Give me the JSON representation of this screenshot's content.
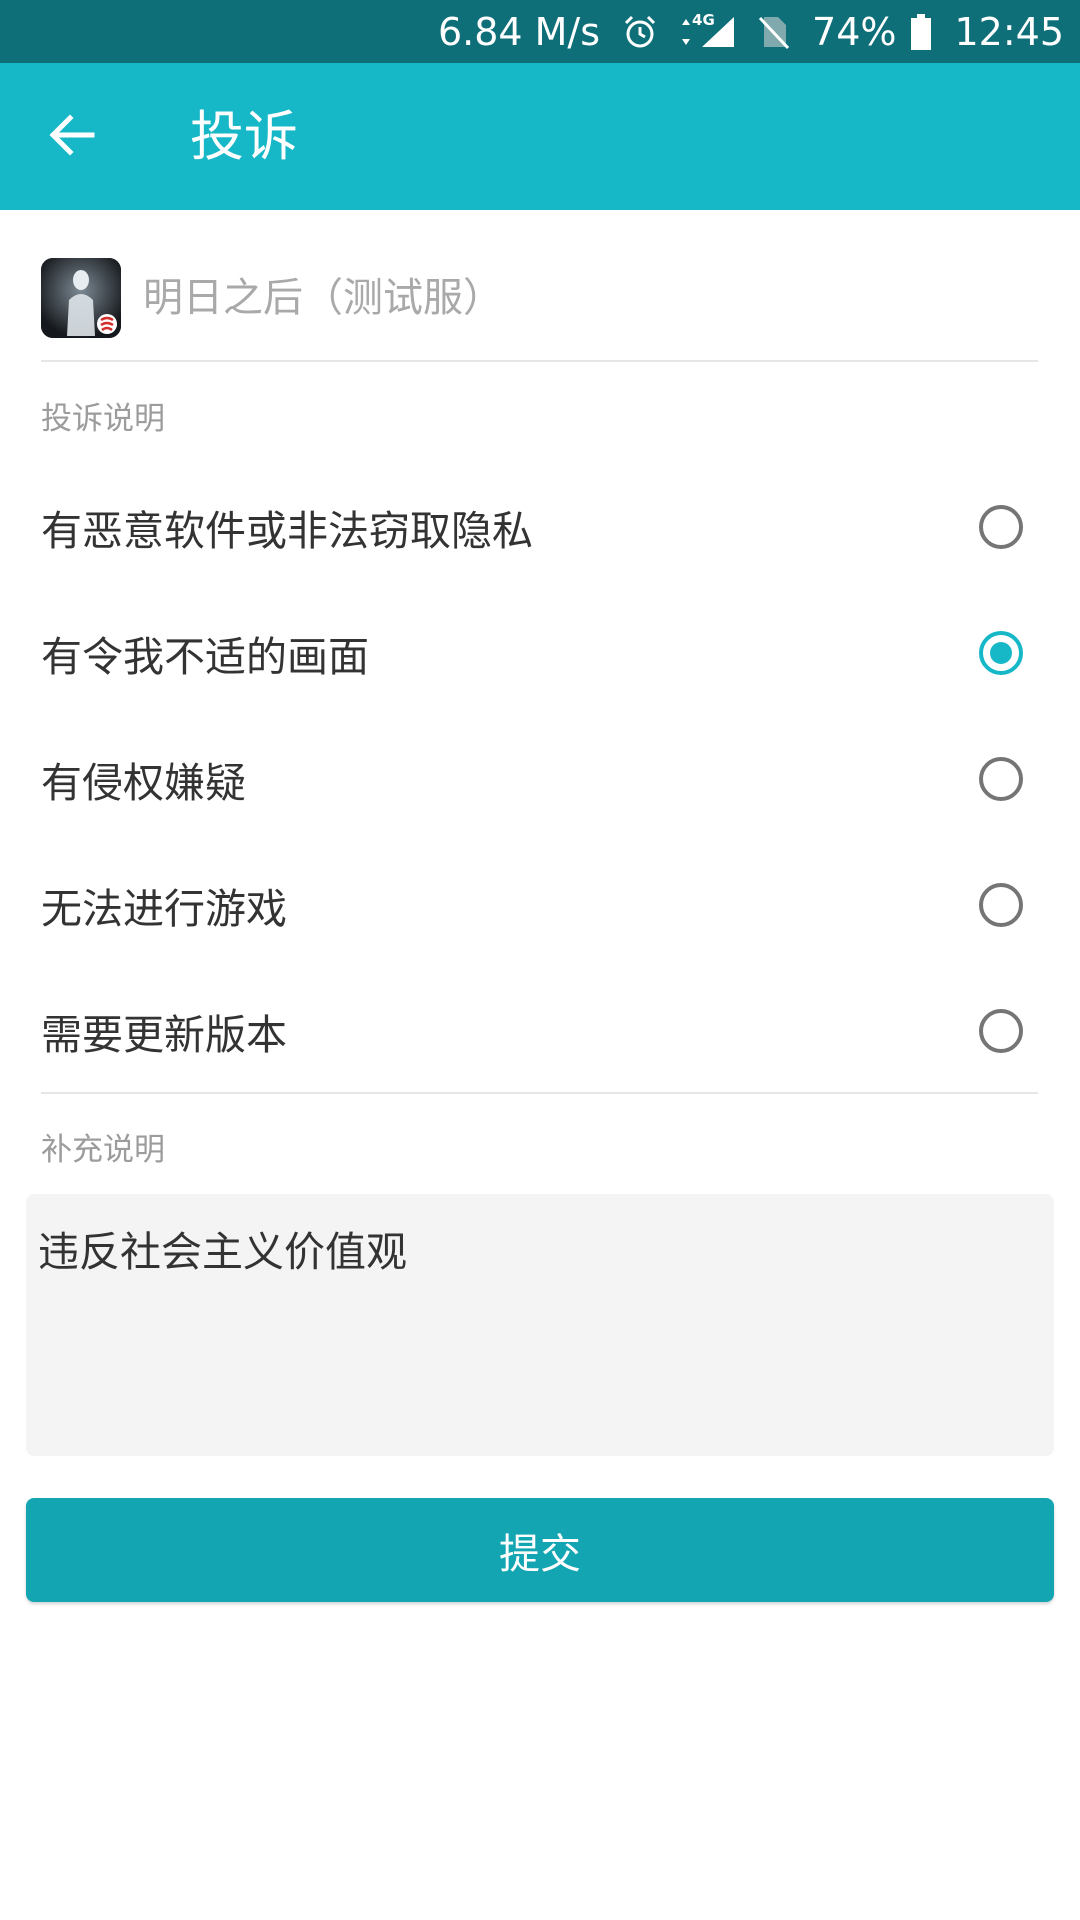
{
  "status_bar": {
    "net_speed": "6.84 M/s",
    "network_label": "4G",
    "battery": "74%",
    "time": "12:45",
    "icons": [
      "alarm-icon",
      "data-arrows-icon",
      "signal-icon",
      "no-sim-icon",
      "battery-icon"
    ]
  },
  "header": {
    "title": "投诉",
    "back_icon": "arrow-left-icon"
  },
  "app": {
    "name": "明日之后（测试服）"
  },
  "complaint": {
    "section_label": "投诉说明",
    "options": [
      {
        "label": "有恶意软件或非法窃取隐私",
        "checked": false
      },
      {
        "label": "有令我不适的画面",
        "checked": true
      },
      {
        "label": "有侵权嫌疑",
        "checked": false
      },
      {
        "label": "无法进行游戏",
        "checked": false
      },
      {
        "label": "需要更新版本",
        "checked": false
      }
    ]
  },
  "supplement": {
    "section_label": "补充说明",
    "value": "违反社会主义价值观"
  },
  "submit": {
    "label": "提交"
  },
  "colors": {
    "status_bar": "#0f6f78",
    "app_bar": "#16b7c7",
    "accent": "#16b7c7",
    "submit_button": "#13a5b2"
  }
}
